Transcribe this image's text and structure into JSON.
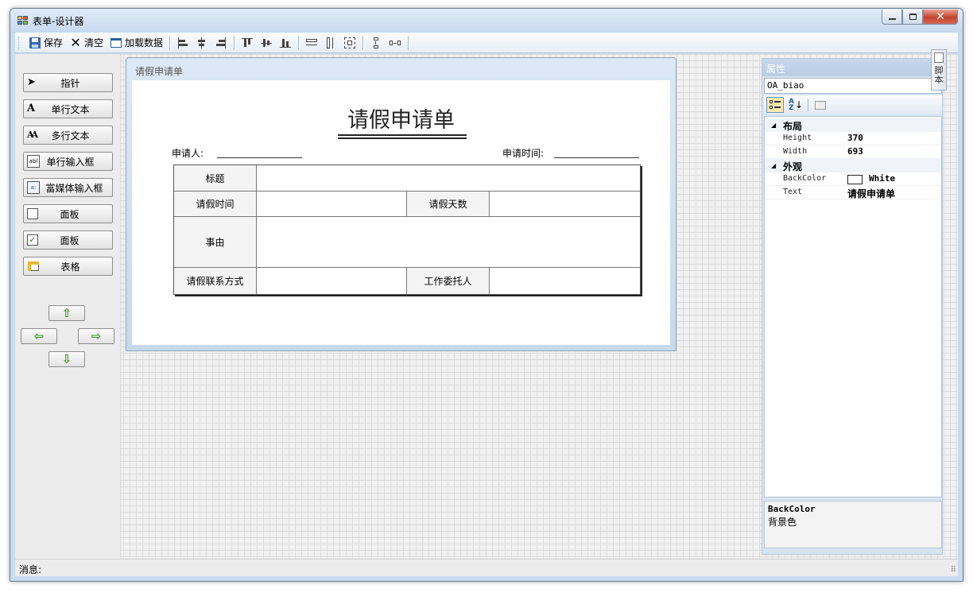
{
  "window": {
    "title": "表单-设计器"
  },
  "toolbar": {
    "save_label": "保存",
    "clear_label": "清空",
    "load_label": "加载数据"
  },
  "toolbox": {
    "items": [
      {
        "label": "指针",
        "icon": "pointer-arrow-icon"
      },
      {
        "label": "单行文本",
        "icon": "letter-a-icon"
      },
      {
        "label": "多行文本",
        "icon": "multi-letter-a-icon"
      },
      {
        "label": "单行输入框",
        "icon": "textbox-abl-icon"
      },
      {
        "label": "富媒体输入框",
        "icon": "richtext-box-icon"
      },
      {
        "label": "面板",
        "icon": "panel-square-icon"
      },
      {
        "label": "面板",
        "icon": "checkbox-checked-icon"
      },
      {
        "label": "表格",
        "icon": "table-grid-icon"
      }
    ],
    "arrows": {
      "up": "⇧",
      "left": "⇦",
      "right": "⇨",
      "down": "⇩"
    }
  },
  "form": {
    "window_title": "请假申请单",
    "doc_title": "请假申请单",
    "applicant_label": "申请人:",
    "date_label": "申请时间:",
    "table": {
      "title_label": "标题",
      "leave_time_label": "请假时间",
      "leave_days_label": "请假天数",
      "reason_label": "事由",
      "contact_label": "请假联系方式",
      "delegate_label": "工作委托人"
    }
  },
  "properties": {
    "header": "属性",
    "object_name": "OA_biao",
    "categories": [
      {
        "name": "布局",
        "rows": [
          {
            "name": "Height",
            "value": "370"
          },
          {
            "name": "Width",
            "value": "693"
          }
        ]
      },
      {
        "name": "外观",
        "rows": [
          {
            "name": "BackColor",
            "value": "White"
          },
          {
            "name": "Text",
            "value": "请假申请单"
          }
        ]
      }
    ],
    "description_name": "BackColor",
    "description_text": "背景色",
    "side_tab": "脚本"
  },
  "status": {
    "label": "消息:"
  },
  "colors": {
    "accent": "#3a9a1a",
    "close_button": "#c4422d",
    "titlebar": "#c6d9ee"
  }
}
